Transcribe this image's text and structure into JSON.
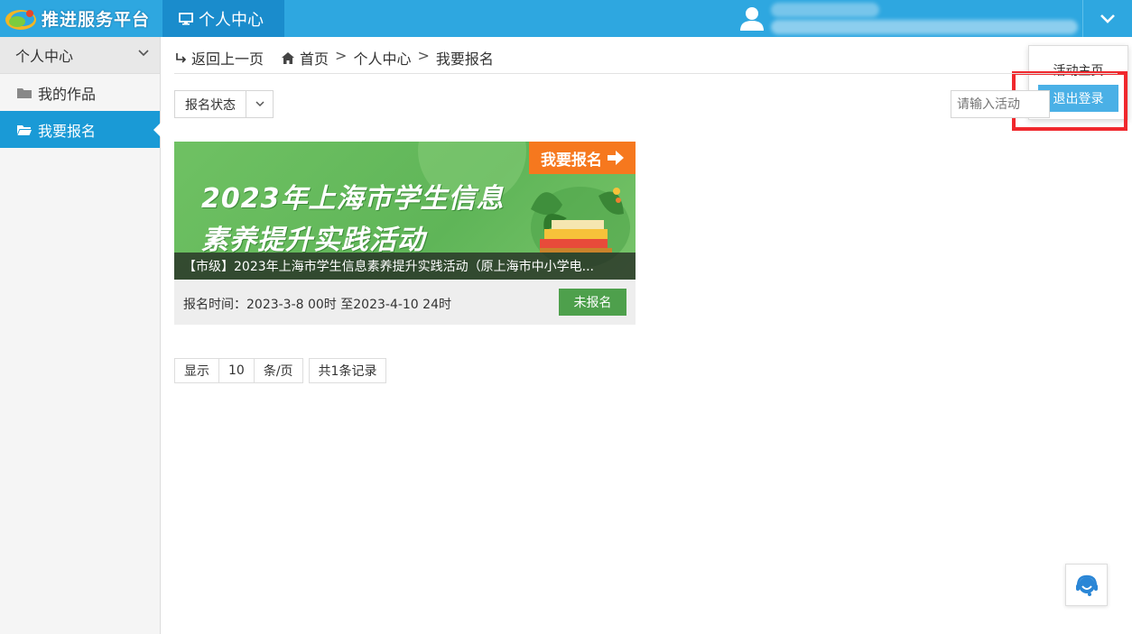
{
  "header": {
    "brand_title": "推进服务平台",
    "active_tab": "个人中心",
    "menu_toggle_icon": "chevron-down-icon"
  },
  "dropdown": {
    "home_label": "活动主页",
    "logout_label": "退出登录"
  },
  "sidebar": {
    "section_title": "个人中心",
    "items": [
      {
        "label": "我的作品",
        "icon": "folder-icon"
      },
      {
        "label": "我要报名",
        "icon": "folder-open-icon"
      }
    ]
  },
  "breadcrumb": {
    "back_label": "返回上一页",
    "home_label": "首页",
    "level1": "个人中心",
    "level2": "我要报名",
    "separator": ">"
  },
  "filters": {
    "status_label": "报名状态",
    "search_placeholder": "请输入活动"
  },
  "card": {
    "banner_line1": "2023年上海市学生信息",
    "banner_line2": "素养提升实践活动",
    "banner_tag": "我要报名",
    "caption": "【市级】2023年上海市学生信息素养提升实践活动（原上海市中小学电...",
    "time_label": "报名时间：2023-3-8 00时 至2023-4-10 24时",
    "status_button": "未报名"
  },
  "pagination": {
    "show_label": "显示",
    "page_size": "10",
    "unit_label": "条/页",
    "total_label": "共1条记录"
  },
  "colors": {
    "topbar": "#2ea7e0",
    "active_tab": "#1a8ccc",
    "sidebar_active": "#1a9ad6",
    "logout_button": "#4ab0e6",
    "status_button": "#4ea04c",
    "banner_tag": "#f6781e",
    "highlight": "#f0282d"
  }
}
